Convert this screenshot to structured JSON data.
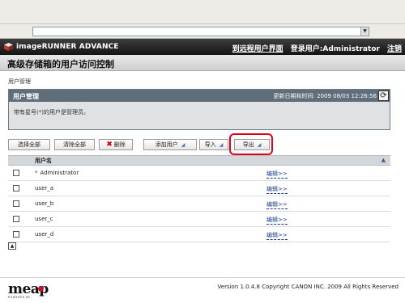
{
  "browser": {
    "address_value": ""
  },
  "brand": {
    "product": "imageRUNNER ADVANCE",
    "links": [
      {
        "label": "到远程用户界面"
      },
      {
        "label": "登录用户:Administrator"
      },
      {
        "label": "注销"
      }
    ]
  },
  "page": {
    "title": "高级存储箱的用户访问控制",
    "breadcrumb": "用户管理"
  },
  "panel": {
    "title": "用户管理",
    "last_updated": "更新日期和时间: 2009 08/03 12:26:56",
    "message": "带有星号(*)的用户是管理员。"
  },
  "toolbar": {
    "select_all": "选择全部",
    "clear_all": "清除全部",
    "delete": "删除",
    "add_user": "添加用户",
    "import": "导入",
    "export": "导出"
  },
  "table": {
    "header": "用户名",
    "rows": [
      {
        "name": "Administrator",
        "admin_mark": "*",
        "edit": "编辑>>"
      },
      {
        "name": "user_a",
        "admin_mark": "",
        "edit": "编辑>>"
      },
      {
        "name": "user_b",
        "admin_mark": "",
        "edit": "编辑>>"
      },
      {
        "name": "user_c",
        "admin_mark": "",
        "edit": "编辑>>"
      },
      {
        "name": "user_d",
        "admin_mark": "",
        "edit": "编辑>>"
      }
    ]
  },
  "footer": {
    "logo": "meap",
    "logo_sub": "POWERED BY",
    "copyright": "Version 1.0.4.8 Copyright CANON INC. 2009 All Rights Reserved"
  },
  "colors": {
    "brand_bar": "#1f1f1f",
    "panel_header": "#5f6e7a",
    "highlight": "#e2001a",
    "link": "#1a3a8a"
  },
  "icons": {
    "refresh": "refresh-icon",
    "delete": "x-icon",
    "dropdown": "dropdown-arrow-icon",
    "sort": "sort-up-icon",
    "collapse": "collapse-icon"
  }
}
